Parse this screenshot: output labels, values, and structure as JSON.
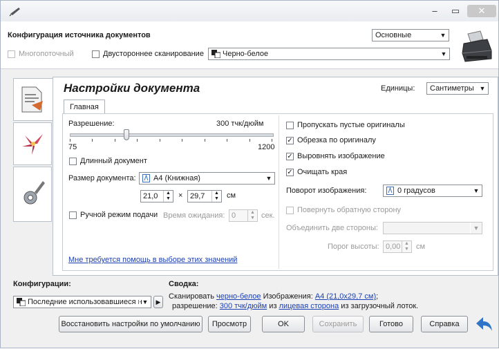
{
  "topbar": {
    "config_label": "Конфигурация источника документов",
    "mode_select": "Основные",
    "multistream_label": "Многопоточный",
    "duplex_label": "Двустороннее сканирование",
    "color_select": "Черно-белое"
  },
  "panel": {
    "title": "Настройки документа",
    "units_label": "Единицы:",
    "units_value": "Сантиметры",
    "tab_main": "Главная"
  },
  "left": {
    "resolution_label": "Разрешение:",
    "resolution_value": "300 тчк/дюйм",
    "resolution_min": "75",
    "resolution_max": "1200",
    "resolution_level": 0.28,
    "long_doc_label": "Длинный документ",
    "doc_size_label": "Размер документа:",
    "doc_size_value": "A4 (Книжная)",
    "width_value": "21,0",
    "times": "×",
    "height_value": "29,7",
    "unit_cm": "см",
    "manual_feed_label": "Ручной режим подачи",
    "wait_label": "Время ожидания:",
    "wait_value": "0",
    "wait_unit": "сек.",
    "help_link": "Мне требуется помощь в выборе этих значений"
  },
  "right": {
    "skip_blank_label": "Пропускать пустые оригиналы",
    "crop_label": "Обрезка по оригиналу",
    "deskew_label": "Выровнять изображение",
    "clean_edges_label": "Очищать края",
    "rotation_label": "Поворот изображения:",
    "rotation_value": "0 градусов",
    "rotate_back_label": "Повернуть обратную сторону",
    "merge_label": "Объединить две стороны:",
    "merge_value": "",
    "height_threshold_label": "Порог высоты:",
    "height_threshold_value": "0,00",
    "height_threshold_unit": "см"
  },
  "bottom": {
    "configs_label": "Конфигурации:",
    "summary_label": "Сводка:",
    "configs_select": "Последние использовавшиеся н",
    "summary_line1_prefix": "Сканировать",
    "summary_line1_link1": "черно-белое",
    "summary_line1_mid": "Изображения:",
    "summary_line1_link2": "A4 (21,0x29,7 см)",
    "summary_line1_suffix": ";",
    "summary_line2_prefix": "разрешение:",
    "summary_line2_link1": "300 тчк/дюйм",
    "summary_line2_mid": "из",
    "summary_line2_link2": "лицевая сторона",
    "summary_line2_suffix": "из  загрузочный лоток.",
    "btn_restore": "Восстановить настройки по умолчанию",
    "btn_preview": "Просмотр",
    "btn_ok": "OK",
    "btn_save": "Сохранить",
    "btn_done": "Готово",
    "btn_help": "Справка"
  },
  "colors": {
    "accent_blue": "#1a3fb5",
    "back_arrow": "#2f74c7"
  }
}
